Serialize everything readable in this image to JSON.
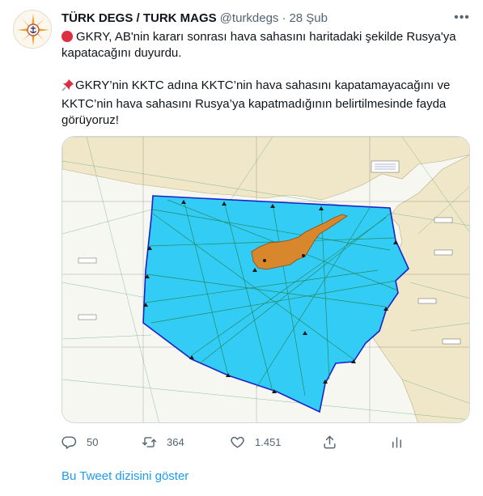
{
  "tweet": {
    "author_name": "TÜRK DEGS / TURK MAGS",
    "handle": "@turkdegs",
    "separator": "·",
    "time": "28 Şub",
    "paragraph_1": "GKRY, AB'nin kararı sonrası hava sahasını haritadaki şekilde Rusya'ya kapatacağını duyurdu.",
    "paragraph_2": "GKRY’nin KKTC adına KKTC’nin hava sahasını kapatamayacağını ve KKTC’nin hava sahasını Rusya’ya kapatmadığının belirtilmesinde fayda görüyoruz!",
    "icons": {
      "bullet_1": "red-circle-emoji",
      "bullet_2": "pushpin-emoji",
      "more": "more-icon"
    }
  },
  "media": {
    "type": "aeronautical-chart-map",
    "colors": {
      "fir_fill": "#33ccf5",
      "fir_border": "#1a22c8",
      "island": "#d9872c",
      "land": "#efe7c8",
      "sea": "#f7f7f2"
    }
  },
  "actions": {
    "reply_count": "50",
    "retweet_count": "364",
    "like_count": "1.451",
    "icons": [
      "reply-icon",
      "retweet-icon",
      "like-icon",
      "share-icon",
      "analytics-icon"
    ]
  },
  "thread_link": "Bu Tweet dizisini göster",
  "colors": {
    "link": "#1d9bf0",
    "muted": "#536471",
    "text": "#0f1419"
  }
}
